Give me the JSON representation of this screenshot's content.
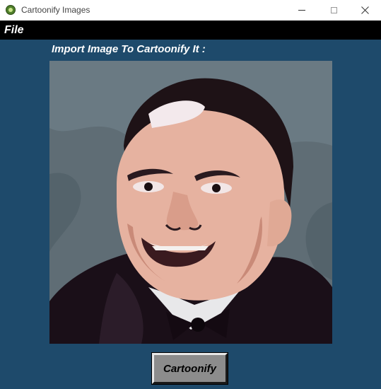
{
  "window": {
    "title": "Cartoonify Images",
    "icon": "app-icon"
  },
  "menu": {
    "file_label": "File"
  },
  "main": {
    "heading": "Import Image To Cartoonify It :",
    "image_alt": "cartoonified portrait",
    "button_label": "Cartoonify"
  },
  "colors": {
    "background": "#1e4a6b",
    "menubar": "#000000",
    "button": "#8c8c8c"
  }
}
